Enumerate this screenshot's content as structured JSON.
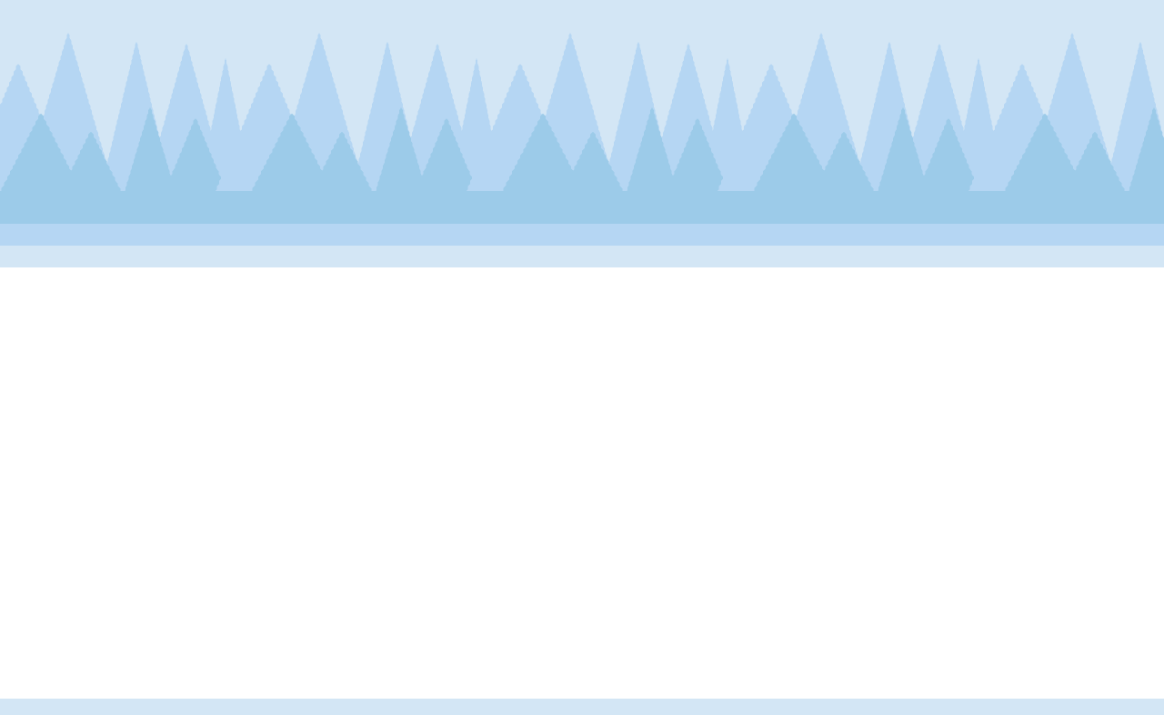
{
  "scene": {
    "type": "side-scrolling game background",
    "layers": [
      "sky",
      "back-forest",
      "mid-forest",
      "front-forest",
      "ground-band",
      "play-area",
      "bottom-strip"
    ]
  },
  "colors": {
    "sky": "#d3e6f5",
    "back_trees": "#b5d6f3",
    "back_tree_detail": "#9fc9ec",
    "front_trees": "#9ccbe9",
    "front_tree_detail": "#8fc0e3",
    "ground_band_1": "#b5d6f3",
    "ground_band_2": "#d3e6f5",
    "play_area": "#ffffff",
    "bottom_strip": "#d3e6f5"
  }
}
